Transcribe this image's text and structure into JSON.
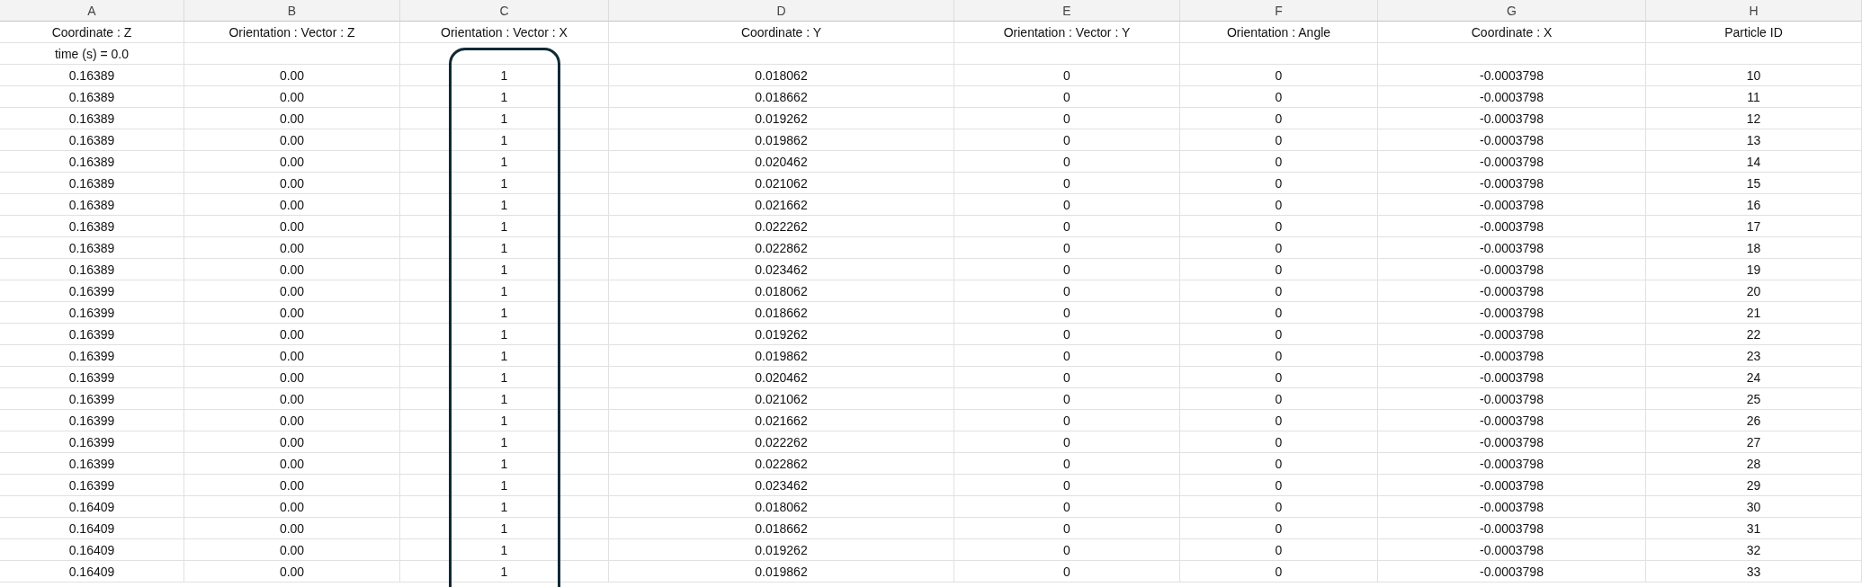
{
  "columns": [
    {
      "letter": "A",
      "header": "Coordinate : Z",
      "highlighted": false
    },
    {
      "letter": "B",
      "header": "Orientation : Vector : Z",
      "highlighted": false
    },
    {
      "letter": "C",
      "header": "Orientation : Vector : X",
      "highlighted": true
    },
    {
      "letter": "D",
      "header": "Coordinate : Y",
      "highlighted": false
    },
    {
      "letter": "E",
      "header": "Orientation : Vector : Y",
      "highlighted": false
    },
    {
      "letter": "F",
      "header": "Orientation : Angle",
      "highlighted": false
    },
    {
      "letter": "G",
      "header": "Coordinate : X",
      "highlighted": false
    },
    {
      "letter": "H",
      "header": "Particle ID",
      "highlighted": false
    }
  ],
  "time_label": "time (s) = 0.0",
  "rows": [
    [
      "0.16389",
      "0.00",
      "1",
      "0.018062",
      "0",
      "0",
      "-0.0003798",
      "10"
    ],
    [
      "0.16389",
      "0.00",
      "1",
      "0.018662",
      "0",
      "0",
      "-0.0003798",
      "11"
    ],
    [
      "0.16389",
      "0.00",
      "1",
      "0.019262",
      "0",
      "0",
      "-0.0003798",
      "12"
    ],
    [
      "0.16389",
      "0.00",
      "1",
      "0.019862",
      "0",
      "0",
      "-0.0003798",
      "13"
    ],
    [
      "0.16389",
      "0.00",
      "1",
      "0.020462",
      "0",
      "0",
      "-0.0003798",
      "14"
    ],
    [
      "0.16389",
      "0.00",
      "1",
      "0.021062",
      "0",
      "0",
      "-0.0003798",
      "15"
    ],
    [
      "0.16389",
      "0.00",
      "1",
      "0.021662",
      "0",
      "0",
      "-0.0003798",
      "16"
    ],
    [
      "0.16389",
      "0.00",
      "1",
      "0.022262",
      "0",
      "0",
      "-0.0003798",
      "17"
    ],
    [
      "0.16389",
      "0.00",
      "1",
      "0.022862",
      "0",
      "0",
      "-0.0003798",
      "18"
    ],
    [
      "0.16389",
      "0.00",
      "1",
      "0.023462",
      "0",
      "0",
      "-0.0003798",
      "19"
    ],
    [
      "0.16399",
      "0.00",
      "1",
      "0.018062",
      "0",
      "0",
      "-0.0003798",
      "20"
    ],
    [
      "0.16399",
      "0.00",
      "1",
      "0.018662",
      "0",
      "0",
      "-0.0003798",
      "21"
    ],
    [
      "0.16399",
      "0.00",
      "1",
      "0.019262",
      "0",
      "0",
      "-0.0003798",
      "22"
    ],
    [
      "0.16399",
      "0.00",
      "1",
      "0.019862",
      "0",
      "0",
      "-0.0003798",
      "23"
    ],
    [
      "0.16399",
      "0.00",
      "1",
      "0.020462",
      "0",
      "0",
      "-0.0003798",
      "24"
    ],
    [
      "0.16399",
      "0.00",
      "1",
      "0.021062",
      "0",
      "0",
      "-0.0003798",
      "25"
    ],
    [
      "0.16399",
      "0.00",
      "1",
      "0.021662",
      "0",
      "0",
      "-0.0003798",
      "26"
    ],
    [
      "0.16399",
      "0.00",
      "1",
      "0.022262",
      "0",
      "0",
      "-0.0003798",
      "27"
    ],
    [
      "0.16399",
      "0.00",
      "1",
      "0.022862",
      "0",
      "0",
      "-0.0003798",
      "28"
    ],
    [
      "0.16399",
      "0.00",
      "1",
      "0.023462",
      "0",
      "0",
      "-0.0003798",
      "29"
    ],
    [
      "0.16409",
      "0.00",
      "1",
      "0.018062",
      "0",
      "0",
      "-0.0003798",
      "30"
    ],
    [
      "0.16409",
      "0.00",
      "1",
      "0.018662",
      "0",
      "0",
      "-0.0003798",
      "31"
    ],
    [
      "0.16409",
      "0.00",
      "1",
      "0.019262",
      "0",
      "0",
      "-0.0003798",
      "32"
    ],
    [
      "0.16409",
      "0.00",
      "1",
      "0.019862",
      "0",
      "0",
      "-0.0003798",
      "33"
    ]
  ]
}
